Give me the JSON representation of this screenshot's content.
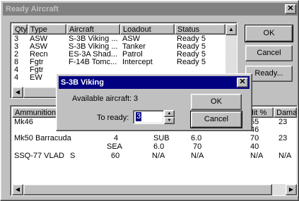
{
  "window": {
    "title": "Ready Aircraft",
    "close_glyph": "✕"
  },
  "aircraft_list": {
    "headers": [
      "Qty",
      "Type",
      "Aircraft",
      "Loadout",
      "Status"
    ],
    "rows": [
      [
        "3",
        "ASW",
        "S-3B Viking ...",
        "ASW",
        "Ready 5"
      ],
      [
        "3",
        "ASW",
        "S-3B Viking ...",
        "Tanker",
        "Ready 5"
      ],
      [
        "2",
        "Recn",
        "ES-3A Shad...",
        "Patrol",
        "Ready 5"
      ],
      [
        "8",
        "Fgtr",
        "F-14B Tomc...",
        "Intercept",
        "Ready 5"
      ],
      [
        "4",
        "Fgtr",
        "",
        "",
        ""
      ],
      [
        "4",
        "EW",
        "",
        "",
        ""
      ]
    ]
  },
  "buttons": {
    "ok": "OK",
    "cancel": "Cancel",
    "ready": "Ready..."
  },
  "ammo_list": {
    "header_left": "Ammunition",
    "header_hit": "Hit %",
    "header_dama": "Dama",
    "rows": [
      {
        "c1": "Mk46",
        "c2": "",
        "c3": "",
        "c4": "",
        "c5": "",
        "c6": "",
        "hit": "55",
        "dama": "23"
      },
      {
        "c1": "",
        "c2": "",
        "c3": "",
        "c4": "",
        "c5": "",
        "c6": "",
        "hit": "46",
        "dama": ""
      },
      {
        "c1": "Mk50 Barracuda",
        "c2": "",
        "c3": "4",
        "c4": "SUB",
        "c5": "6.0",
        "c6": "",
        "hit": "70",
        "dama": "23"
      },
      {
        "c1": "",
        "c2": "",
        "c3": "SEA",
        "c4": "6.0",
        "c5": "70",
        "c6": "",
        "hit": "40",
        "dama": ""
      },
      {
        "c1": "SSQ-77 VLAD",
        "c2": "S",
        "c3": "60",
        "c4": "N/A",
        "c5": "N/A",
        "c6": "",
        "hit": "N/A",
        "dama": "N/A"
      }
    ]
  },
  "dialog": {
    "title": "S-3B Viking",
    "close_glyph": "✕",
    "available_label": "Available aircraft:",
    "available_value": "3",
    "to_ready_label": "To ready:",
    "to_ready_value": "3",
    "ok": "OK",
    "cancel": "Cancel"
  },
  "icons": {
    "up": "▲",
    "down": "▼",
    "left": "◀",
    "right": "▶"
  }
}
